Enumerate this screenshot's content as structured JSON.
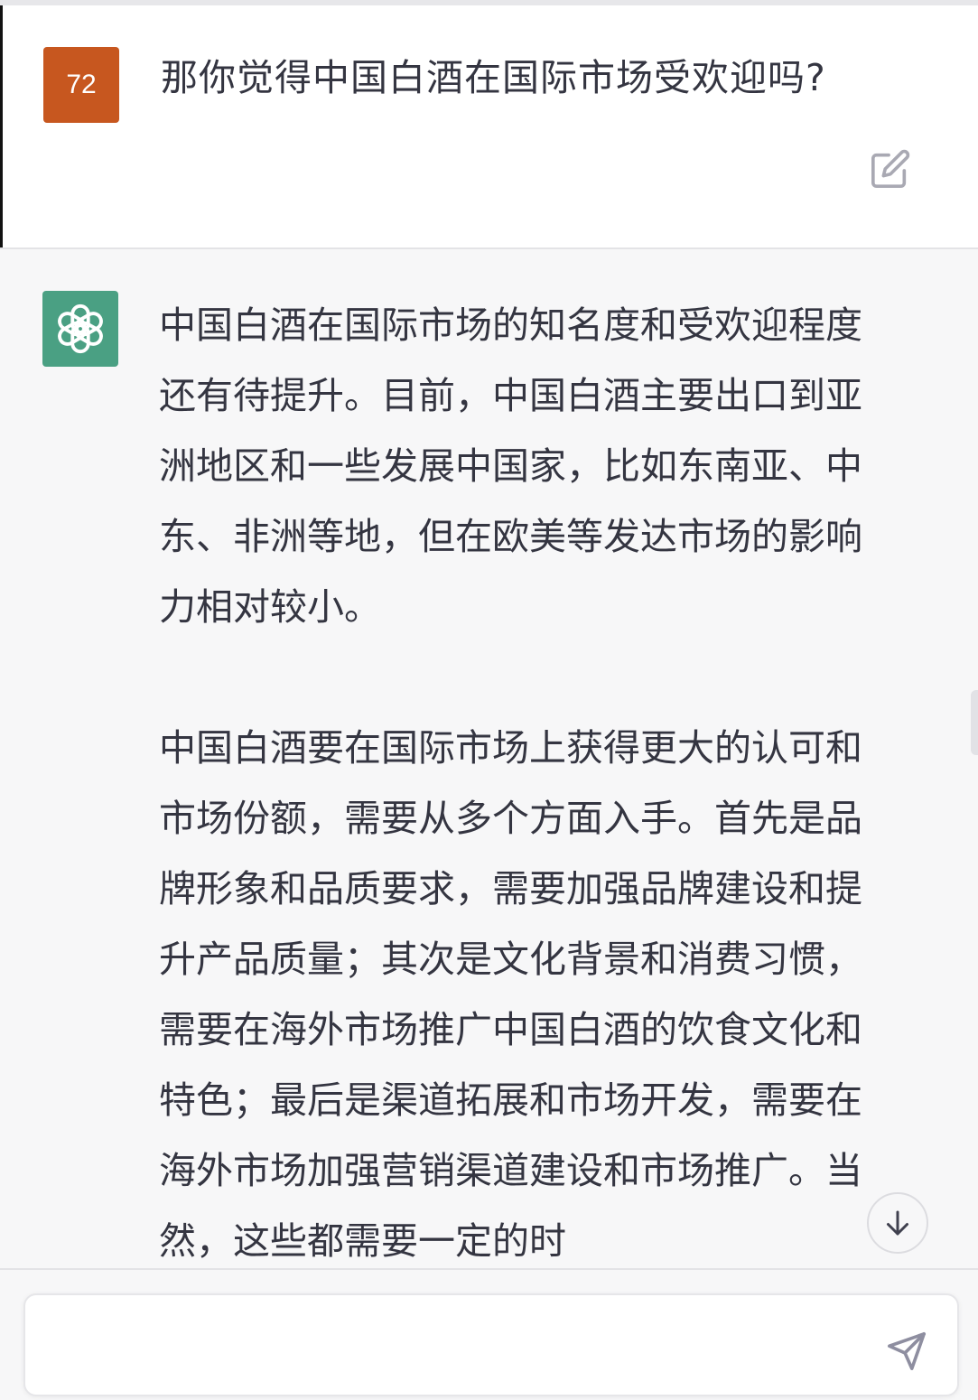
{
  "user_message": {
    "avatar_label": "72",
    "avatar_color": "#c7571f",
    "text": "那你觉得中国白酒在国际市场受欢迎吗?",
    "edit_icon": "edit-icon"
  },
  "assistant_message": {
    "avatar_icon": "chatgpt-logo-icon",
    "avatar_color": "#4aa083",
    "paragraphs": [
      "中国白酒在国际市场的知名度和受欢迎程度还有待提升。目前，中国白酒主要出口到亚洲地区和一些发展中国家，比如东南亚、中东、非洲等地，但在欧美等发达市场的影响力相对较小。",
      "中国白酒要在国际市场上获得更大的认可和市场份额，需要从多个方面入手。首先是品牌形象和品质要求，需要加强品牌建设和提升产品质量；其次是文化背景和消费习惯，需要在海外市场推广中国白酒的饮食文化和特色；最后是渠道拓展和市场开发，需要在海外市场加强营销渠道建设和市场推广。当然，这些都需要一定的时"
    ]
  },
  "scroll_down_icon": "arrow-down-icon",
  "composer": {
    "value": "",
    "send_icon": "send-icon"
  }
}
